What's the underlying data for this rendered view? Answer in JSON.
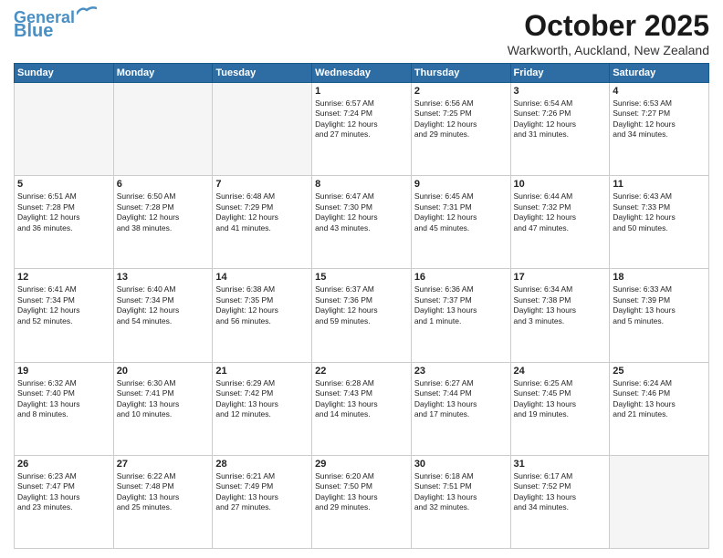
{
  "header": {
    "logo_line1": "General",
    "logo_line2": "Blue",
    "month": "October 2025",
    "location": "Warkworth, Auckland, New Zealand"
  },
  "days_of_week": [
    "Sunday",
    "Monday",
    "Tuesday",
    "Wednesday",
    "Thursday",
    "Friday",
    "Saturday"
  ],
  "weeks": [
    [
      {
        "day": "",
        "info": ""
      },
      {
        "day": "",
        "info": ""
      },
      {
        "day": "",
        "info": ""
      },
      {
        "day": "1",
        "info": "Sunrise: 6:57 AM\nSunset: 7:24 PM\nDaylight: 12 hours\nand 27 minutes."
      },
      {
        "day": "2",
        "info": "Sunrise: 6:56 AM\nSunset: 7:25 PM\nDaylight: 12 hours\nand 29 minutes."
      },
      {
        "day": "3",
        "info": "Sunrise: 6:54 AM\nSunset: 7:26 PM\nDaylight: 12 hours\nand 31 minutes."
      },
      {
        "day": "4",
        "info": "Sunrise: 6:53 AM\nSunset: 7:27 PM\nDaylight: 12 hours\nand 34 minutes."
      }
    ],
    [
      {
        "day": "5",
        "info": "Sunrise: 6:51 AM\nSunset: 7:28 PM\nDaylight: 12 hours\nand 36 minutes."
      },
      {
        "day": "6",
        "info": "Sunrise: 6:50 AM\nSunset: 7:28 PM\nDaylight: 12 hours\nand 38 minutes."
      },
      {
        "day": "7",
        "info": "Sunrise: 6:48 AM\nSunset: 7:29 PM\nDaylight: 12 hours\nand 41 minutes."
      },
      {
        "day": "8",
        "info": "Sunrise: 6:47 AM\nSunset: 7:30 PM\nDaylight: 12 hours\nand 43 minutes."
      },
      {
        "day": "9",
        "info": "Sunrise: 6:45 AM\nSunset: 7:31 PM\nDaylight: 12 hours\nand 45 minutes."
      },
      {
        "day": "10",
        "info": "Sunrise: 6:44 AM\nSunset: 7:32 PM\nDaylight: 12 hours\nand 47 minutes."
      },
      {
        "day": "11",
        "info": "Sunrise: 6:43 AM\nSunset: 7:33 PM\nDaylight: 12 hours\nand 50 minutes."
      }
    ],
    [
      {
        "day": "12",
        "info": "Sunrise: 6:41 AM\nSunset: 7:34 PM\nDaylight: 12 hours\nand 52 minutes."
      },
      {
        "day": "13",
        "info": "Sunrise: 6:40 AM\nSunset: 7:34 PM\nDaylight: 12 hours\nand 54 minutes."
      },
      {
        "day": "14",
        "info": "Sunrise: 6:38 AM\nSunset: 7:35 PM\nDaylight: 12 hours\nand 56 minutes."
      },
      {
        "day": "15",
        "info": "Sunrise: 6:37 AM\nSunset: 7:36 PM\nDaylight: 12 hours\nand 59 minutes."
      },
      {
        "day": "16",
        "info": "Sunrise: 6:36 AM\nSunset: 7:37 PM\nDaylight: 13 hours\nand 1 minute."
      },
      {
        "day": "17",
        "info": "Sunrise: 6:34 AM\nSunset: 7:38 PM\nDaylight: 13 hours\nand 3 minutes."
      },
      {
        "day": "18",
        "info": "Sunrise: 6:33 AM\nSunset: 7:39 PM\nDaylight: 13 hours\nand 5 minutes."
      }
    ],
    [
      {
        "day": "19",
        "info": "Sunrise: 6:32 AM\nSunset: 7:40 PM\nDaylight: 13 hours\nand 8 minutes."
      },
      {
        "day": "20",
        "info": "Sunrise: 6:30 AM\nSunset: 7:41 PM\nDaylight: 13 hours\nand 10 minutes."
      },
      {
        "day": "21",
        "info": "Sunrise: 6:29 AM\nSunset: 7:42 PM\nDaylight: 13 hours\nand 12 minutes."
      },
      {
        "day": "22",
        "info": "Sunrise: 6:28 AM\nSunset: 7:43 PM\nDaylight: 13 hours\nand 14 minutes."
      },
      {
        "day": "23",
        "info": "Sunrise: 6:27 AM\nSunset: 7:44 PM\nDaylight: 13 hours\nand 17 minutes."
      },
      {
        "day": "24",
        "info": "Sunrise: 6:25 AM\nSunset: 7:45 PM\nDaylight: 13 hours\nand 19 minutes."
      },
      {
        "day": "25",
        "info": "Sunrise: 6:24 AM\nSunset: 7:46 PM\nDaylight: 13 hours\nand 21 minutes."
      }
    ],
    [
      {
        "day": "26",
        "info": "Sunrise: 6:23 AM\nSunset: 7:47 PM\nDaylight: 13 hours\nand 23 minutes."
      },
      {
        "day": "27",
        "info": "Sunrise: 6:22 AM\nSunset: 7:48 PM\nDaylight: 13 hours\nand 25 minutes."
      },
      {
        "day": "28",
        "info": "Sunrise: 6:21 AM\nSunset: 7:49 PM\nDaylight: 13 hours\nand 27 minutes."
      },
      {
        "day": "29",
        "info": "Sunrise: 6:20 AM\nSunset: 7:50 PM\nDaylight: 13 hours\nand 29 minutes."
      },
      {
        "day": "30",
        "info": "Sunrise: 6:18 AM\nSunset: 7:51 PM\nDaylight: 13 hours\nand 32 minutes."
      },
      {
        "day": "31",
        "info": "Sunrise: 6:17 AM\nSunset: 7:52 PM\nDaylight: 13 hours\nand 34 minutes."
      },
      {
        "day": "",
        "info": ""
      }
    ]
  ]
}
